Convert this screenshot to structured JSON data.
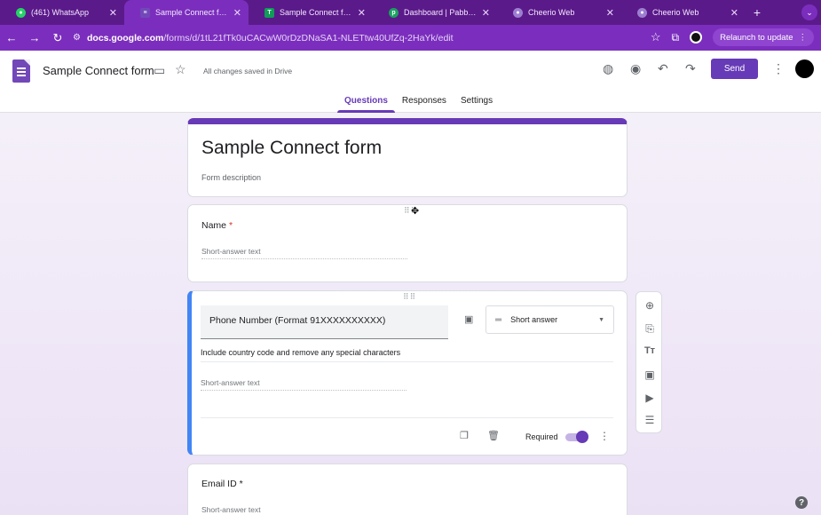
{
  "browser": {
    "tabs": [
      {
        "title": "(461) WhatsApp",
        "icon": "whatsapp-icon",
        "color": "#25d366"
      },
      {
        "title": "Sample Connect form - Go",
        "icon": "google-forms-icon",
        "color": "#7248b9"
      },
      {
        "title": "Sample Connect form (Re",
        "icon": "google-sheets-icon",
        "color": "#0f9d58"
      },
      {
        "title": "Dashboard | Pabbly Conn",
        "icon": "pabbly-icon",
        "color": "#1aa260"
      },
      {
        "title": "Cheerio Web",
        "icon": "cheerio-icon",
        "color": "#9c7fd0"
      },
      {
        "title": "Cheerio Web",
        "icon": "cheerio-icon",
        "color": "#9c7fd0"
      }
    ],
    "url_host": "docs.google.com",
    "url_path": "/forms/d/1tL21fTk0uCACwW0rDzDNaSA1-NLETtw40UfZq-2HaYk/edit",
    "relaunch_label": "Relaunch to update"
  },
  "header": {
    "form_title": "Sample Connect form",
    "saved_status": "All changes saved in Drive",
    "send_label": "Send",
    "tabs": [
      {
        "label": "Questions"
      },
      {
        "label": "Responses"
      },
      {
        "label": "Settings"
      }
    ]
  },
  "form": {
    "title": "Sample Connect form",
    "description_placeholder": "Form description",
    "questions": [
      {
        "label": "Name",
        "required_mark": "*",
        "answer_placeholder": "Short-answer text"
      },
      {
        "label": "Phone Number (Format 91XXXXXXXXXX)",
        "type": "Short answer",
        "description": "Include country code and remove any special characters",
        "answer_placeholder": "Short-answer text",
        "required_label": "Required",
        "required": true
      },
      {
        "label": "Email ID",
        "required_mark": "*",
        "answer_placeholder": "Short-answer text"
      }
    ]
  },
  "colors": {
    "accent": "#673ab7",
    "active_border": "#4285f4",
    "tabstrip": "#5b1a8a",
    "toolbar": "#7b2ebd"
  }
}
